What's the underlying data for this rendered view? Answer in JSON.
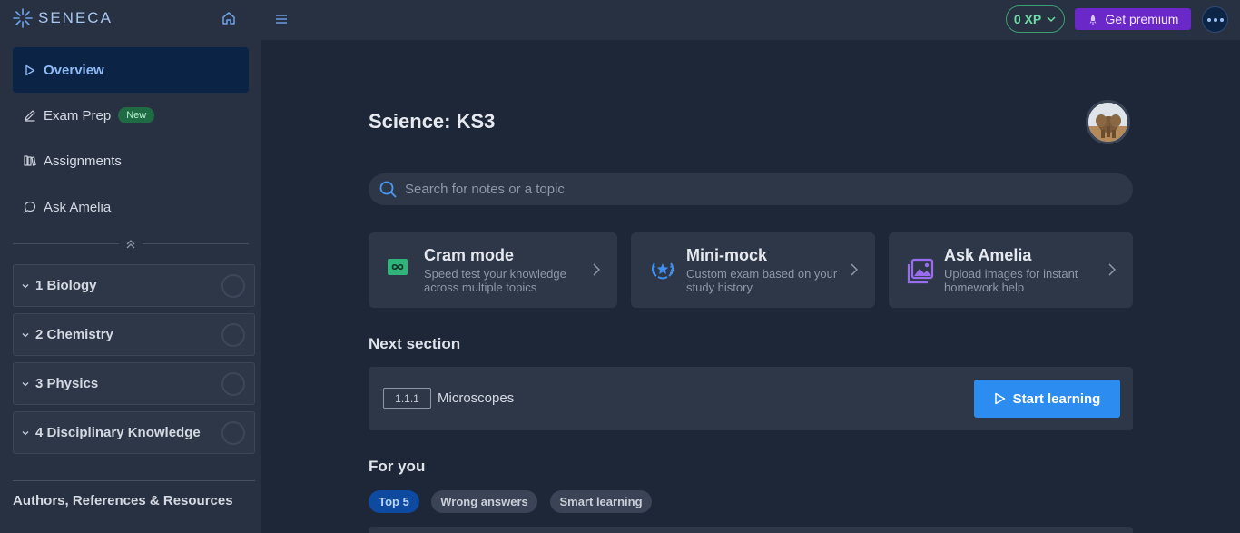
{
  "logo": {
    "text": "SENECA"
  },
  "sidebar": {
    "nav": [
      {
        "label": "Overview",
        "icon": "play-icon",
        "active": true
      },
      {
        "label": "Exam Prep",
        "icon": "pencil-icon",
        "badge": "New"
      },
      {
        "label": "Assignments",
        "icon": "books-icon"
      },
      {
        "label": "Ask Amelia",
        "icon": "chat-bubble-icon"
      }
    ],
    "topics": [
      {
        "label": "1 Biology"
      },
      {
        "label": "2 Chemistry"
      },
      {
        "label": "3 Physics"
      },
      {
        "label": "4 Disciplinary Knowledge"
      }
    ],
    "footer_link": "Authors, References & Resources"
  },
  "topbar": {
    "xp": "0 XP",
    "premium_label": "Get premium"
  },
  "main": {
    "title": "Science: KS3",
    "search_placeholder": "Search for notes or a topic",
    "cards": [
      {
        "title": "Cram mode",
        "desc": "Speed test your knowledge across multiple topics",
        "icon": "infinity-icon",
        "color": "#2fb57a"
      },
      {
        "title": "Mini-mock",
        "desc": "Custom exam based on your study history",
        "icon": "laurel-star-icon",
        "color": "#3d8ff0"
      },
      {
        "title": "Ask Amelia",
        "desc": "Upload images for instant homework help",
        "icon": "image-stack-icon",
        "color": "#9a6cf0"
      }
    ],
    "next_section_heading": "Next section",
    "next_section": {
      "number": "1.1.1",
      "name": "Microscopes",
      "button": "Start learning"
    },
    "for_you_heading": "For you",
    "chips": [
      {
        "label": "Top 5",
        "active": true
      },
      {
        "label": "Wrong answers",
        "active": false
      },
      {
        "label": "Smart learning",
        "active": false
      }
    ]
  }
}
